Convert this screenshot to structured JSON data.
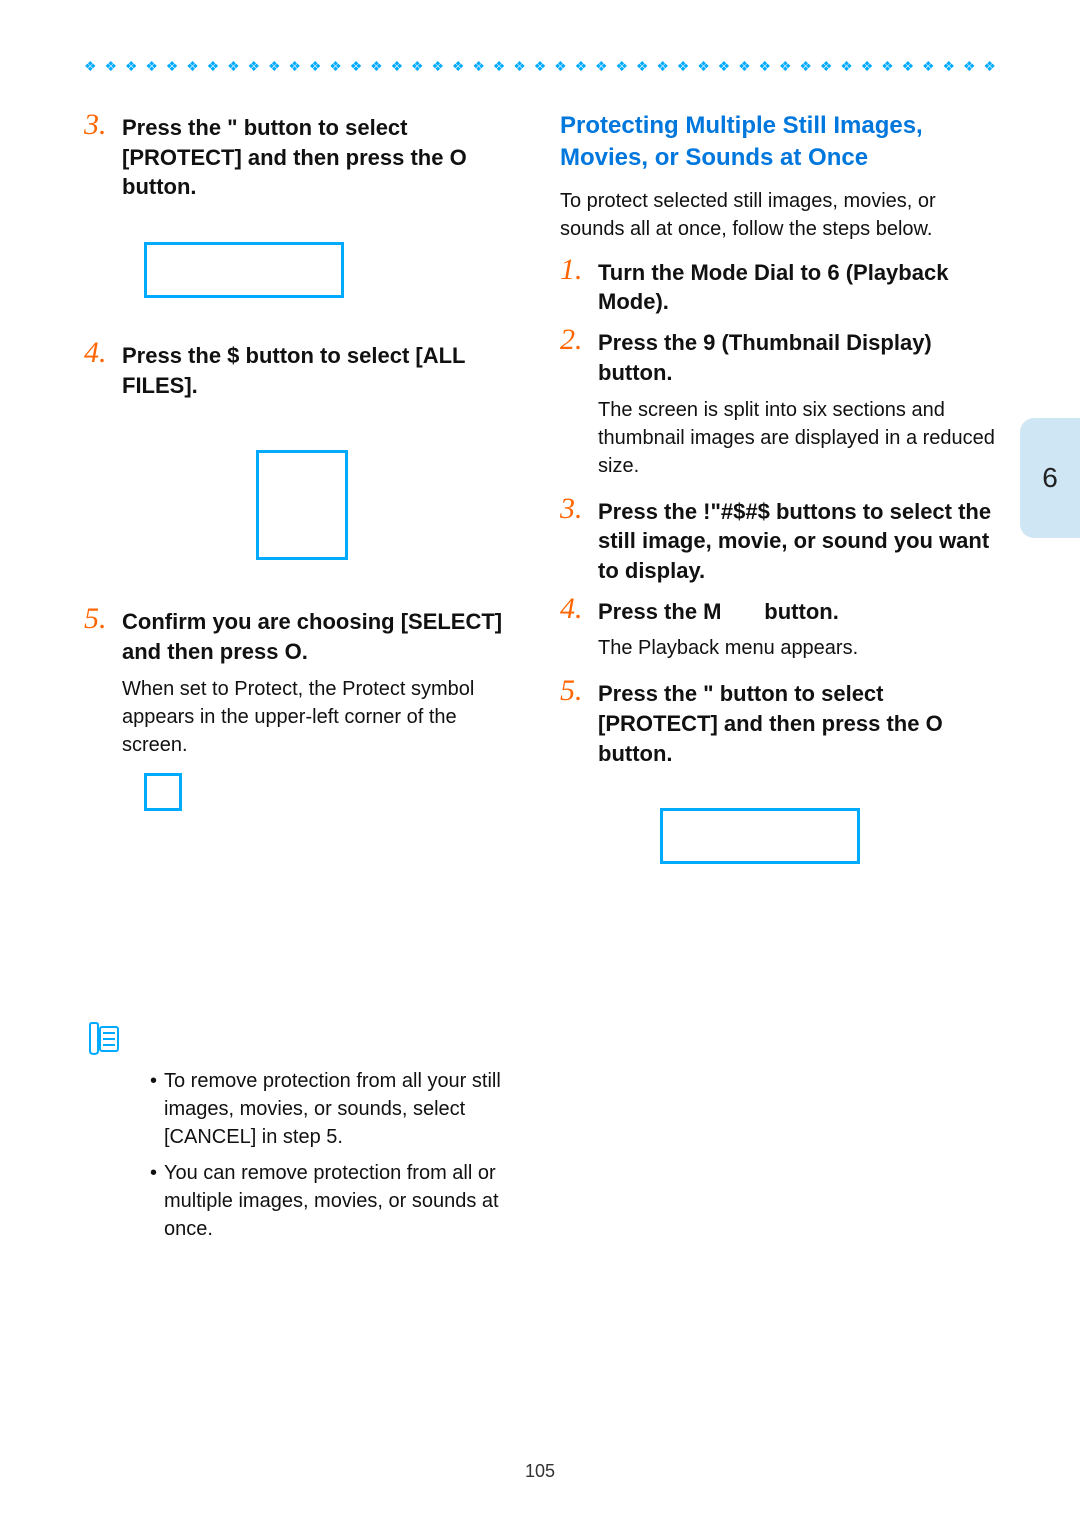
{
  "page_number": "105",
  "side_tab": "6",
  "left": {
    "step3": {
      "num": "3.",
      "text": "Press the \" button to select [PROTECT] and then press the O button."
    },
    "step4": {
      "num": "4.",
      "text": "Press the $ button to select [ALL FILES]."
    },
    "step5": {
      "num": "5.",
      "text": "Confirm you are choosing [SELECT] and then press O.",
      "body": "When set to Protect, the Protect symbol appears in the upper-left corner of the screen."
    },
    "notes": {
      "bullet1": "To remove protection from all your still images, movies, or sounds, select [CANCEL] in step 5.",
      "bullet2": "You can remove protection from all or multiple images, movies, or sounds at once."
    }
  },
  "right": {
    "heading": "Protecting Multiple Still Images, Movies, or Sounds at Once",
    "intro": "To protect selected still images, movies, or sounds all at once, follow the steps below.",
    "step1": {
      "num": "1.",
      "text": "Turn the Mode Dial to 6 (Playback Mode)."
    },
    "step2": {
      "num": "2.",
      "text": "Press the 9 (Thumbnail Display) button.",
      "body": "The screen is split into six sections and thumbnail images are displayed in a reduced size."
    },
    "step3": {
      "num": "3.",
      "text": "Press the !\"#$#$ buttons to select the still image, movie, or sound you want to display."
    },
    "step4": {
      "num": "4.",
      "text_a": "Press the M",
      "text_b": "button.",
      "body": "The Playback menu appears."
    },
    "step5": {
      "num": "5.",
      "text": "Press the \" button to select [PROTECT] and then press the O button."
    }
  }
}
